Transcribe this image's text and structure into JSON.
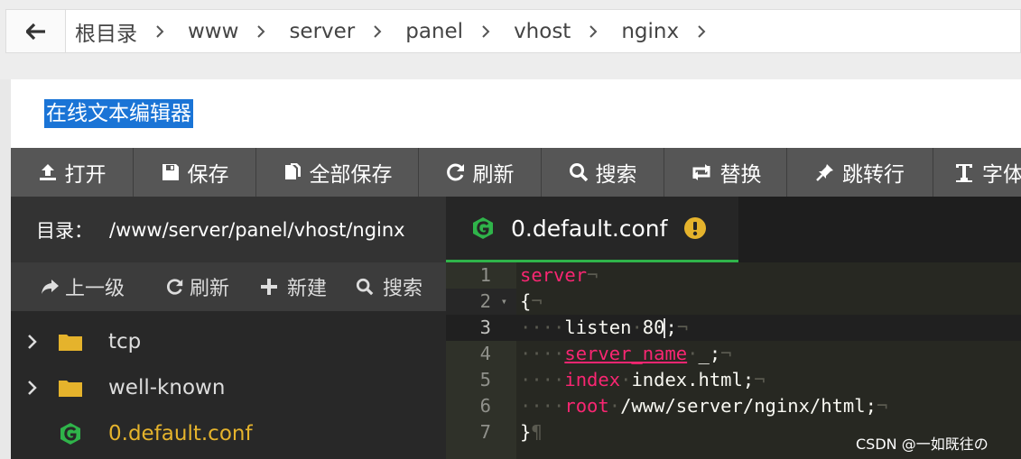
{
  "breadcrumb": {
    "items": [
      "根目录",
      "www",
      "server",
      "panel",
      "vhost",
      "nginx"
    ]
  },
  "modal": {
    "title": "在线文本编辑器"
  },
  "toolbar": {
    "buttons": [
      {
        "label": "打开",
        "icon": "upload-icon"
      },
      {
        "label": "保存",
        "icon": "save-icon"
      },
      {
        "label": "全部保存",
        "icon": "save-all-icon"
      },
      {
        "label": "刷新",
        "icon": "refresh-icon"
      },
      {
        "label": "搜索",
        "icon": "search-icon"
      },
      {
        "label": "替换",
        "icon": "replace-icon"
      },
      {
        "label": "跳转行",
        "icon": "pin-icon"
      },
      {
        "label": "字体",
        "icon": "text-height-icon"
      }
    ]
  },
  "sidebar": {
    "dir_label": "目录：",
    "dir_path": "/www/server/panel/vhost/nginx",
    "tools": [
      {
        "label": "上一级",
        "icon": "share-icon"
      },
      {
        "label": "刷新",
        "icon": "refresh-icon"
      },
      {
        "label": "新建",
        "icon": "plus-icon"
      },
      {
        "label": "搜索",
        "icon": "search-icon"
      }
    ],
    "tree": [
      {
        "name": "tcp",
        "type": "folder"
      },
      {
        "name": "well-known",
        "type": "folder"
      },
      {
        "name": "0.default.conf",
        "type": "file"
      }
    ]
  },
  "editor": {
    "tab_name": "0.default.conf",
    "lines": [
      {
        "num": "1",
        "fold": ""
      },
      {
        "num": "2",
        "fold": "▾"
      },
      {
        "num": "3",
        "fold": ""
      },
      {
        "num": "4",
        "fold": ""
      },
      {
        "num": "5",
        "fold": ""
      },
      {
        "num": "6",
        "fold": ""
      },
      {
        "num": "7",
        "fold": ""
      }
    ],
    "code": {
      "l1_kw": "server",
      "l2": "{",
      "l3_a": "listen",
      "l3_b": "80",
      "l3_c": ";",
      "l4_kw": "server_name",
      "l4_b": "_;",
      "l5_kw": "index",
      "l5_b": "index.html;",
      "l6_kw": "root",
      "l6_b": "/www/server/nginx/html;",
      "l7": "}",
      "eol": "¬",
      "eof": "¶",
      "dots": "····"
    }
  },
  "watermark": "CSDN @一如既往の",
  "colors": {
    "toolbar_bg": "#565656",
    "editor_bg": "#272822",
    "keyword": "#f92672",
    "tab_accent": "#2fb44a",
    "folder": "#e5b32c",
    "selection": "#1a74d6"
  }
}
